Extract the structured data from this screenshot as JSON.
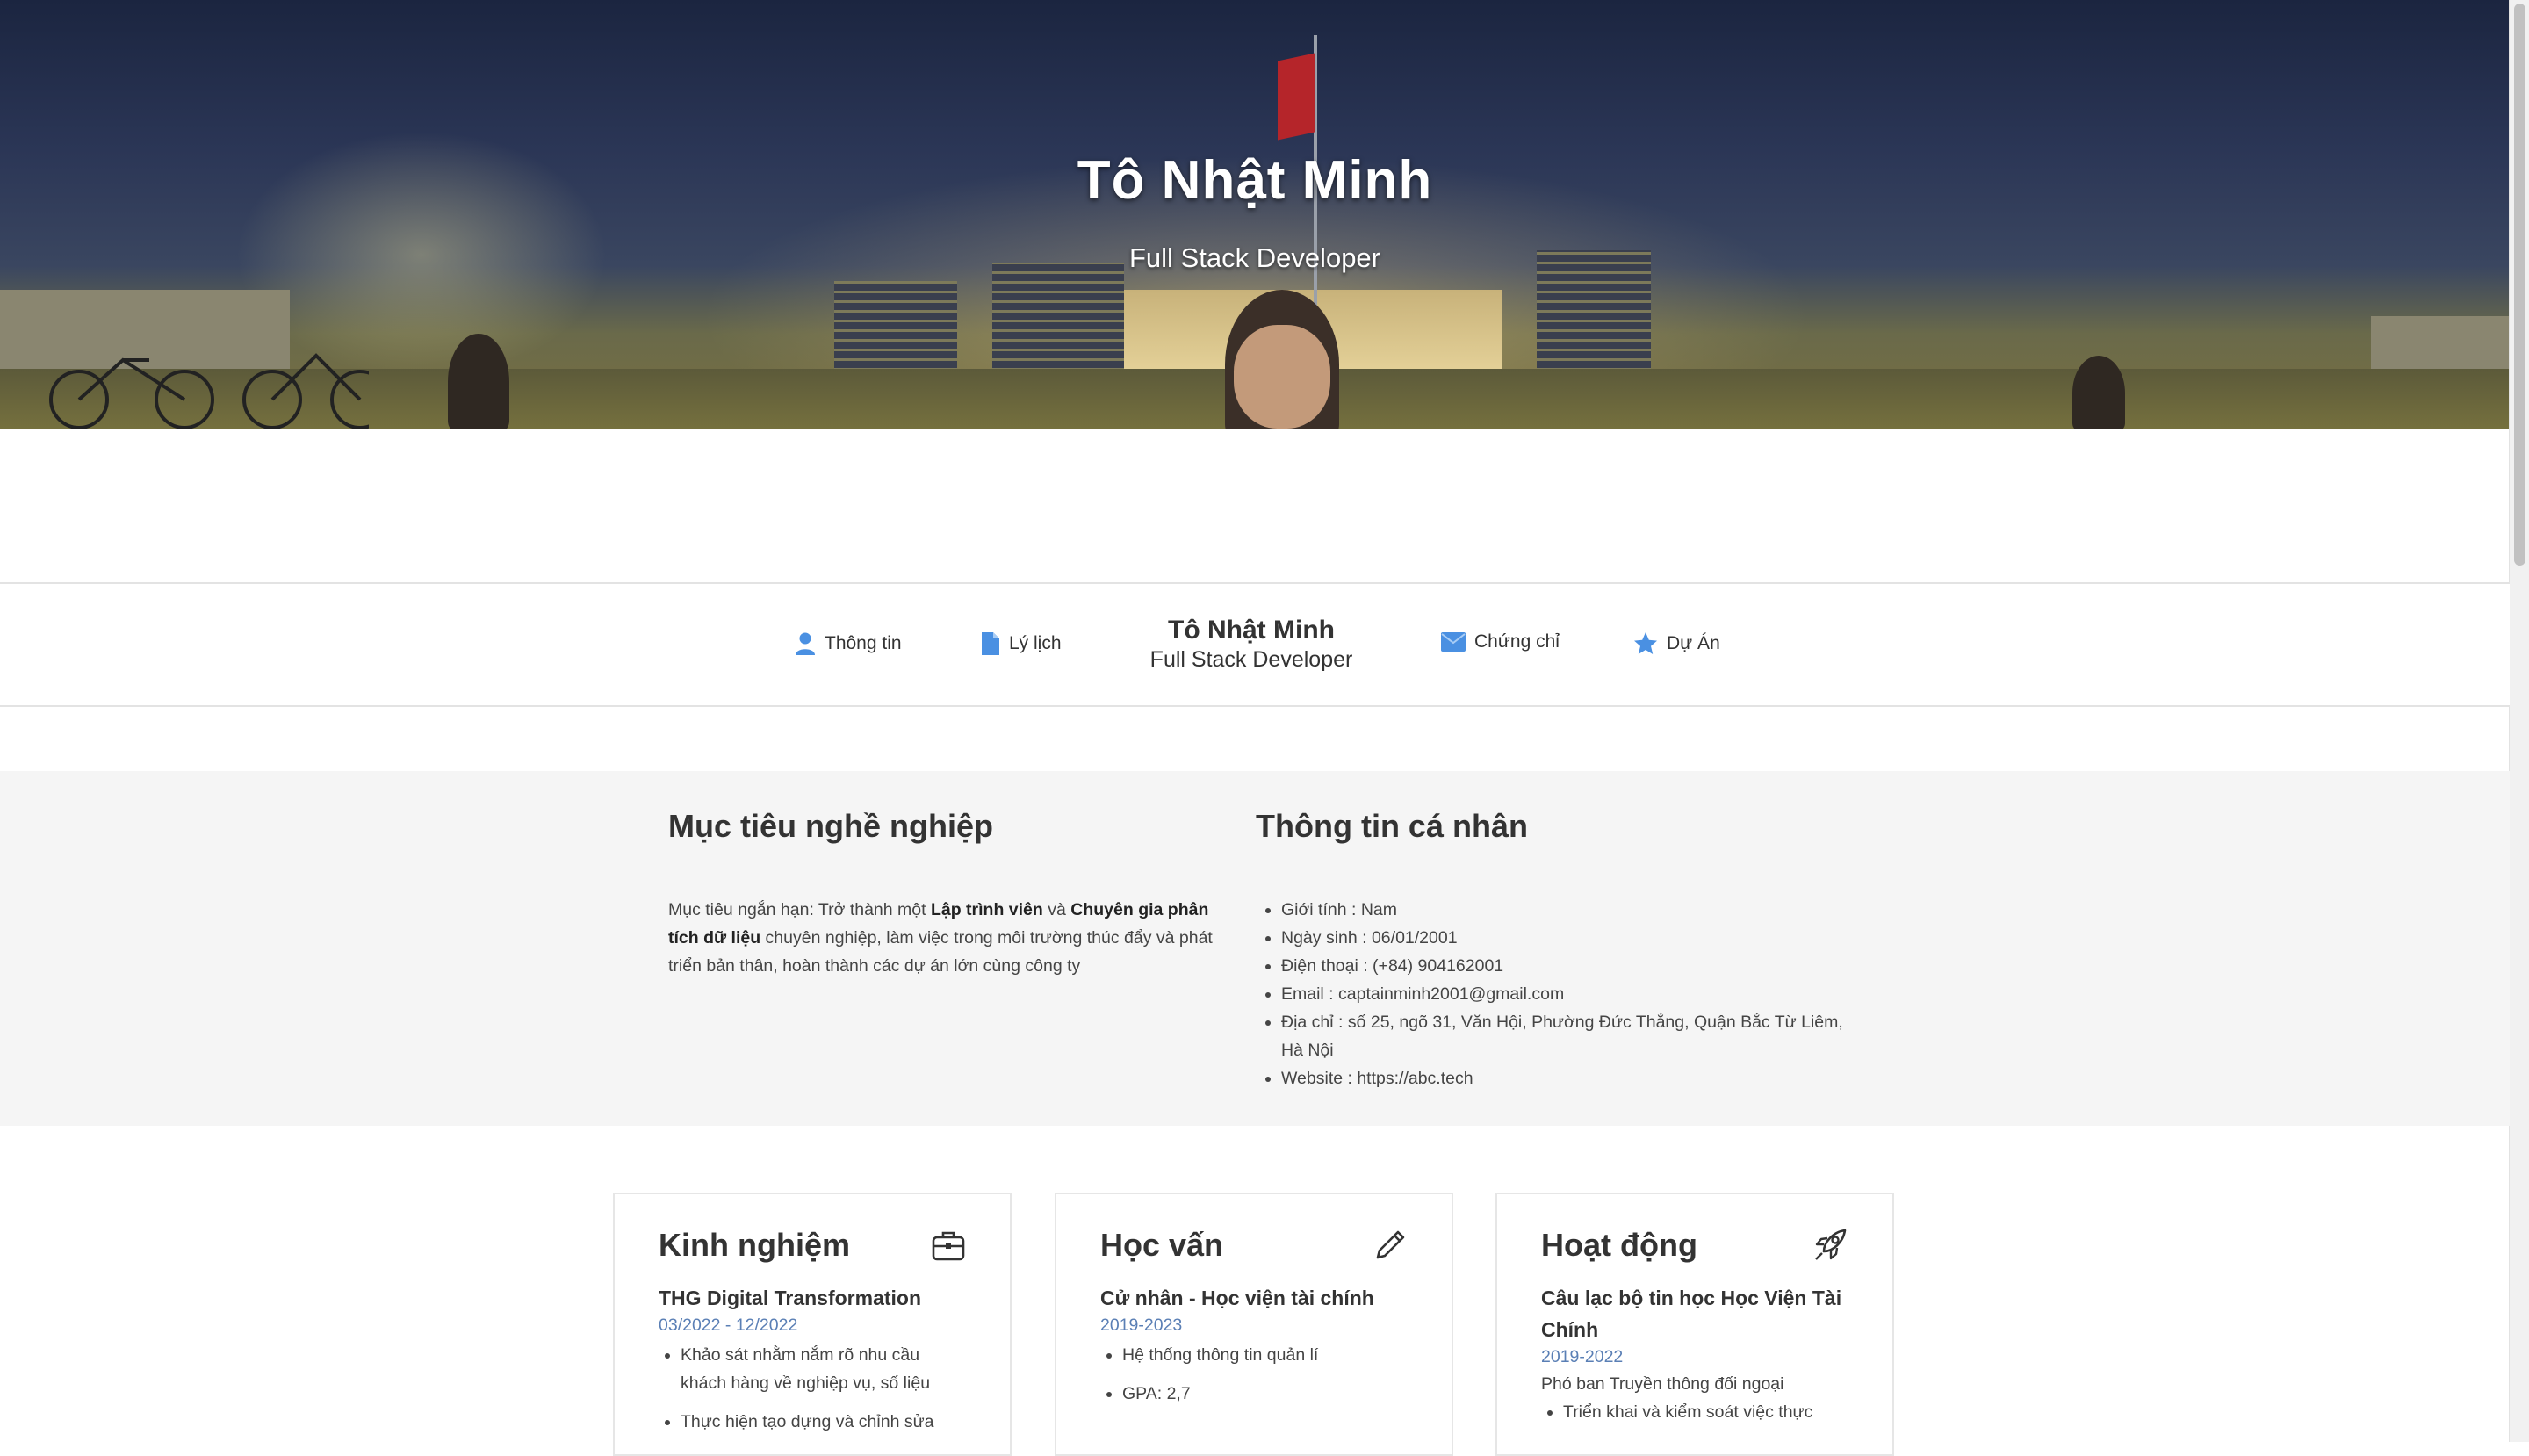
{
  "hero": {
    "name": "Tô Nhật Minh",
    "title": "Full Stack Developer"
  },
  "nav": {
    "items": [
      {
        "label": "Thông tin",
        "icon": "user-icon"
      },
      {
        "label": "Lý lịch",
        "icon": "document-icon"
      },
      {
        "label": "Chứng chỉ",
        "icon": "envelope-icon"
      },
      {
        "label": "Dự Án",
        "icon": "star-icon"
      }
    ],
    "brand_name": "Tô Nhật Minh",
    "brand_title": "Full Stack Developer"
  },
  "about": {
    "goal_heading": "Mục tiêu nghề nghiệp",
    "goal": {
      "prefix": "Mục tiêu ngắn hạn: Trở thành một ",
      "bold1": "Lập trình viên",
      "mid": " và ",
      "bold2": "Chuyên gia phân tích dữ liệu",
      "suffix": " chuyên nghiệp, làm việc trong môi trường thúc đẩy và phát triển bản thân, hoàn thành các dự án lớn cùng công ty"
    },
    "info_heading": "Thông tin cá nhân",
    "info": [
      "Giới tính : Nam",
      "Ngày sinh : 06/01/2001",
      "Điện thoại : (+84) 904162001",
      "Email : captainminh2001@gmail.com",
      "Địa chỉ : số 25, ngõ 31, Văn Hội, Phường Đức Thắng, Quận Bắc Từ Liêm, Hà Nội",
      "Website : https://abc.tech"
    ]
  },
  "cards": {
    "experience": {
      "title": "Kinh nghiệm",
      "icon": "briefcase-icon",
      "org": "THG Digital Transformation",
      "date": "03/2022 - 12/2022",
      "items": [
        "Khảo sát nhằm nắm rõ nhu cầu khách hàng về nghiệp vụ, số liệu",
        "Thực hiện tạo dựng và chỉnh sửa"
      ]
    },
    "education": {
      "title": "Học vấn",
      "icon": "pencil-icon",
      "org": "Cử nhân - Học viện tài chính",
      "date": "2019-2023",
      "items": [
        "Hệ thống thông tin quản lí",
        "GPA: 2,7"
      ]
    },
    "activity": {
      "title": "Hoạt động",
      "icon": "rocket-icon",
      "org": "Câu lạc bộ tin học Học Viện Tài Chính",
      "date": "2019-2022",
      "role": "Phó ban Truyền thông đối ngoại",
      "items": [
        "Triển khai và kiểm soát việc thực"
      ]
    }
  },
  "colors": {
    "accent_date": "#5a7fb5",
    "section_bg": "#f5f5f5",
    "icon_blue": "#4a90e2"
  }
}
